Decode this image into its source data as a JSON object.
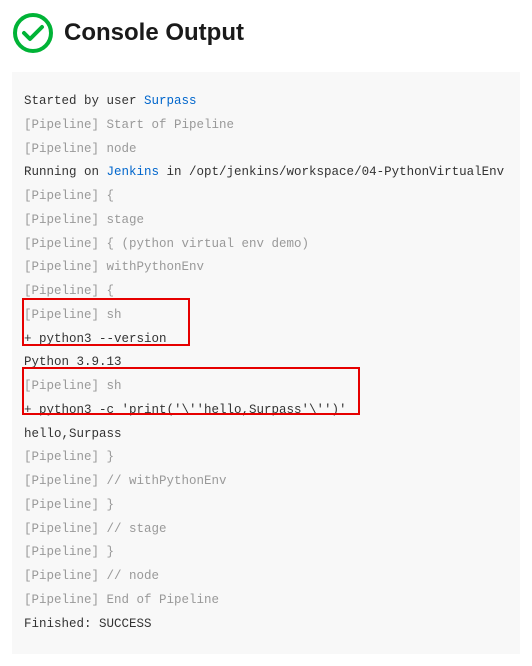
{
  "header": {
    "title": "Console Output",
    "icon_name": "success-checkmark"
  },
  "console": {
    "started_by_prefix": "Started by user ",
    "started_by_user": "Surpass",
    "lines": {
      "l1": "[Pipeline] Start of Pipeline",
      "l2": "[Pipeline] node",
      "running_prefix": "Running on ",
      "running_node": "Jenkins",
      "running_suffix": " in /opt/jenkins/workspace/04-PythonVirtualEnv",
      "l4": "[Pipeline] {",
      "l5": "[Pipeline] stage",
      "l6": "[Pipeline] { (python virtual env demo)",
      "l7": "[Pipeline] withPythonEnv",
      "l8": "[Pipeline] {",
      "l9": "[Pipeline] sh",
      "l10": "+ python3 --version",
      "l11": "Python 3.9.13",
      "l12": "[Pipeline] sh",
      "l13": "+ python3 -c 'print('\\''hello,Surpass'\\'')'",
      "l14": "hello,Surpass",
      "l15": "[Pipeline] }",
      "l16": "[Pipeline] // withPythonEnv",
      "l17": "[Pipeline] }",
      "l18": "[Pipeline] // stage",
      "l19": "[Pipeline] }",
      "l20": "[Pipeline] // node",
      "l21": "[Pipeline] End of Pipeline",
      "l22": "Finished: SUCCESS"
    }
  },
  "colors": {
    "success_green": "#00b336",
    "link_blue": "#0066cc",
    "highlight_red": "#e60000",
    "muted_gray": "#999999"
  }
}
